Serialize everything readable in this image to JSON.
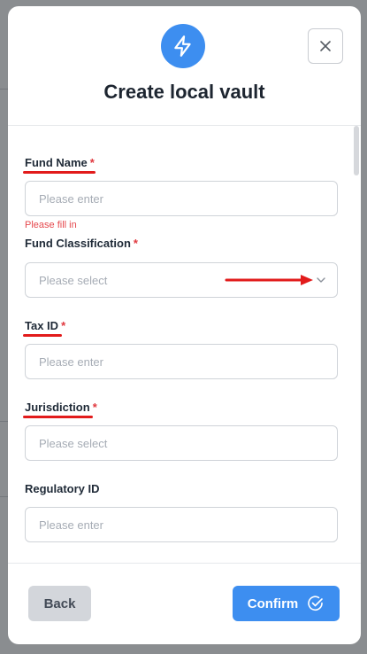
{
  "modal": {
    "title": "Create local vault",
    "icon": "lightning-bolt-icon",
    "close_icon": "close-icon"
  },
  "form": {
    "fund_name": {
      "label": "Fund Name",
      "required": "*",
      "placeholder": "Please enter",
      "error": "Please fill in"
    },
    "fund_classification": {
      "label": "Fund Classification",
      "required": "*",
      "placeholder": "Please select"
    },
    "tax_id": {
      "label": "Tax ID",
      "required": "*",
      "placeholder": "Please enter"
    },
    "jurisdiction": {
      "label": "Jurisdiction",
      "required": "*",
      "placeholder": "Please select"
    },
    "regulatory_id": {
      "label": "Regulatory ID",
      "placeholder": "Please enter"
    }
  },
  "footer": {
    "back_label": "Back",
    "confirm_label": "Confirm",
    "confirm_icon": "check-circle-icon"
  },
  "colors": {
    "accent": "#3d8ef0",
    "required": "#e0383e",
    "annotation": "#e21b1b"
  }
}
